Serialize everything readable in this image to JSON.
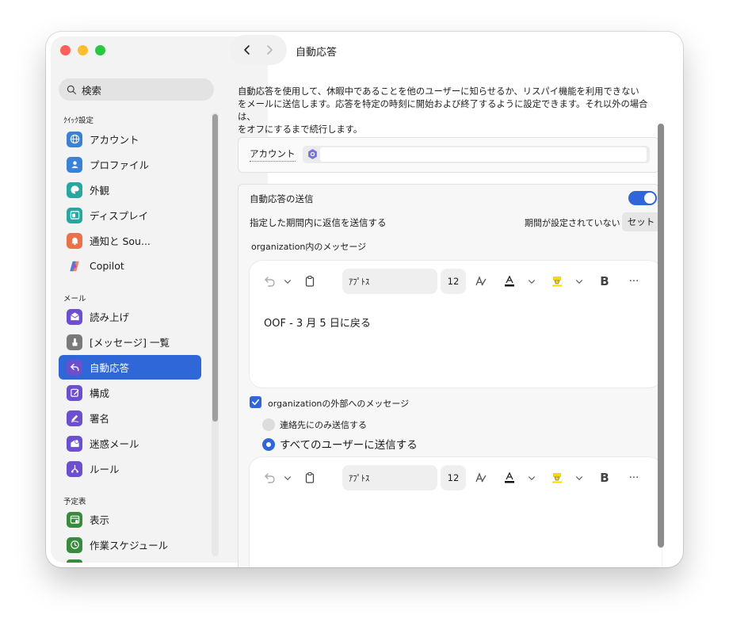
{
  "window": {
    "title": "自動応答"
  },
  "sidebar": {
    "search_placeholder": "検索",
    "sections": {
      "quick": "ｸｲｯｸ設定",
      "mail": "メール",
      "calendar": "予定表"
    },
    "items": [
      {
        "label": "アカウント",
        "icon": "globe-icon",
        "color": "#3b82d6"
      },
      {
        "label": "プロファイル",
        "icon": "person-icon",
        "color": "#3b82d6"
      },
      {
        "label": "外観",
        "icon": "palette-icon",
        "color": "#27a7a0"
      },
      {
        "label": "ディスプレイ",
        "icon": "display-icon",
        "color": "#27a7a0"
      },
      {
        "label": "通知と Sou...",
        "icon": "bell-icon",
        "color": "#e8734a"
      },
      {
        "label": "Copilot",
        "icon": "copilot-icon",
        "color": "#ffffff"
      },
      {
        "label": "読み上げ",
        "icon": "envelope-icon",
        "color": "#6b4fcf"
      },
      {
        "label": "[メッセージ] 一覧",
        "icon": "touch-icon",
        "color": "#7a7a7a"
      },
      {
        "label": "自動応答",
        "icon": "reply-icon",
        "color": "#6b4fcf"
      },
      {
        "label": "構成",
        "icon": "compose-icon",
        "color": "#6b4fcf"
      },
      {
        "label": "署名",
        "icon": "signature-icon",
        "color": "#6b4fcf"
      },
      {
        "label": "迷惑メール",
        "icon": "junk-icon",
        "color": "#6b4fcf"
      },
      {
        "label": "ルール",
        "icon": "rules-icon",
        "color": "#6b4fcf"
      },
      {
        "label": "表示",
        "icon": "calendar-view-icon",
        "color": "#3a8a3e"
      },
      {
        "label": "作業スケジュール",
        "icon": "clock-icon",
        "color": "#3a8a3e"
      }
    ]
  },
  "content": {
    "description_lines": [
      "自動応答を使用して、休暇中であることを他のユーザーに知らせるか、リスパイ機能を利用できない",
      "をメールに送信します。応答を特定の時刻に開始および終了するように設定できます。それ以外の場合は、",
      "をオフにするまで続行します。"
    ],
    "account_label": "アカウント",
    "send_auto_reply_label": "自動応答の送信",
    "period_label": "指定した期間内に返信を送信する",
    "period_status": "期間が設定されていない",
    "set_button": "セット",
    "inside_org_label": "organization内のメッセージ",
    "editor1": {
      "font": "ｱﾌﾟﾄｽ",
      "size": "12",
      "text": "OOF - 3 月 5 日に戻る"
    },
    "outside_org_label": "organizationの外部へのメッセージ",
    "radio_contacts": "連絡先にのみ送信する",
    "radio_all": "すべてのユーザーに送信する",
    "editor2": {
      "font": "ｱﾌﾟﾄｽ",
      "size": "12",
      "text": ""
    }
  },
  "colors": {
    "accent": "#2f66d8",
    "highlight": "#f5d90a"
  }
}
